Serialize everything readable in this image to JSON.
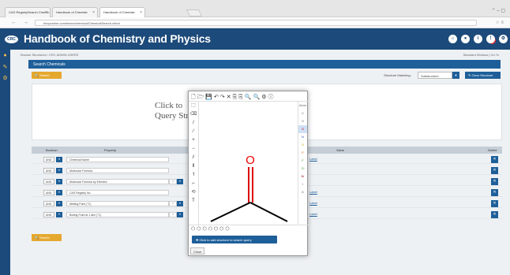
{
  "browser": {
    "tabs": [
      {
        "label": "CAS RegistrySearch Chemic"
      },
      {
        "label": "Handbook of Chemistr"
      },
      {
        "label": "Handbook of Chemistr"
      }
    ],
    "url": "hbcponline.com/faces/chemical/ChemicalSearch.xhtml",
    "window_controls": "⌃ – ▢"
  },
  "header": {
    "logo": "CRC",
    "title": "Handbook of Chemistry and Physics",
    "icons": [
      "home-icon",
      "user-icon",
      "info-icon",
      "notification-icon",
      "settings-icon"
    ]
  },
  "breadcrumb": "Browse Structures / CRC ADMIN USERS",
  "resize_link": "Standard Window | Go To",
  "section_title": "Search Chemicals",
  "toolbar": {
    "search_label": "Search",
    "structure_matching_label": "Structure Matching:",
    "structure_matching_value": "Substructure",
    "clear_label": "Clear Structure"
  },
  "draw_area": {
    "line1": "Click to",
    "line2": "Query Str"
  },
  "table": {
    "headers": {
      "boolean": "Boolean",
      "property": "Property",
      "value": "Value",
      "delete": "Delete"
    },
    "rows": [
      {
        "boolean": "AND",
        "property": "Chemical Name",
        "op": "",
        "value": "Label"
      },
      {
        "boolean": "AND",
        "property": "Molecular Formula",
        "op": "",
        "value": ""
      },
      {
        "boolean": "AND",
        "property": "Molecular Formula by Element",
        "op": "=",
        "value": ""
      },
      {
        "boolean": "AND",
        "property": "CAS Registry No.",
        "op": "",
        "value": "Label"
      },
      {
        "boolean": "AND",
        "property": "Melting Point (°C)",
        "op": "=",
        "value": "Label"
      },
      {
        "boolean": "AND",
        "property": "Boiling Point at 1 atm (°C)",
        "op": "=",
        "value": "Label"
      }
    ]
  },
  "search_bottom_label": "Search",
  "editor": {
    "top_tools": "🗋🗁💾↶↷✕⎘⎘🔍🔍⚙ⓘ",
    "left_tools": [
      "⬚",
      "⌫",
      "/",
      "⁄",
      "+",
      "−",
      "⫽",
      "⫴",
      "⭡",
      "⌐",
      "⟲",
      "T"
    ],
    "right_tools": [
      "Atom",
      "C",
      "H",
      "O",
      "N",
      "S",
      "P",
      "F",
      "Cl",
      "Br",
      "I",
      "D"
    ],
    "bottom_tools": "⬠⬡⬡⬠⬡⬡⬡",
    "atom_label": "O",
    "add_button": "Click to add structure to search query",
    "close_button": "Close"
  }
}
